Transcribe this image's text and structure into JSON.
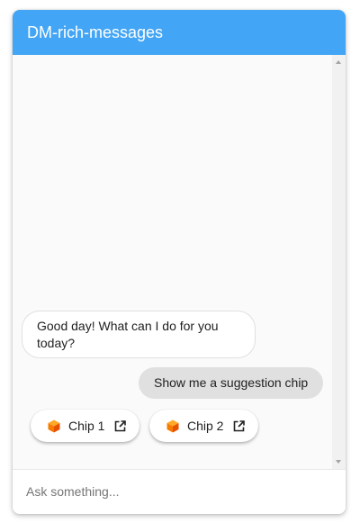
{
  "header": {
    "title": "DM-rich-messages"
  },
  "messages": [
    {
      "sender": "bot",
      "text": "Good day! What can I do for you today?"
    },
    {
      "sender": "user",
      "text": "Show me a suggestion chip"
    }
  ],
  "chips": [
    {
      "label": "Chip 1",
      "icon": "orange-cube-icon",
      "link_icon": "external-link-icon"
    },
    {
      "label": "Chip 2",
      "icon": "orange-cube-icon",
      "link_icon": "external-link-icon"
    }
  ],
  "input": {
    "placeholder": "Ask something...",
    "value": ""
  },
  "colors": {
    "header_bg": "#42a5f5",
    "user_bubble_bg": "#e0e0e0",
    "bot_bubble_bg": "#ffffff",
    "chip_icon": "#f57c00"
  }
}
